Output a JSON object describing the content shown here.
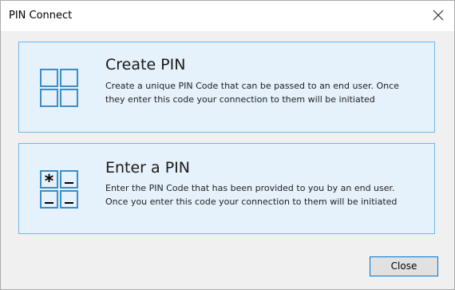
{
  "window": {
    "title": "PIN Connect",
    "close_icon": "close-icon"
  },
  "options": [
    {
      "title": "Create PIN",
      "description_line1": "Create a unique PIN Code that can be passed to an end user. Once",
      "description_line2": "they enter this code your connection to them will be initiated",
      "icon": "grid-icon"
    },
    {
      "title": "Enter a PIN",
      "description_line1": "Enter the PIN Code that has been provided to you by an end user.",
      "description_line2": "Once you enter this code your connection to them will be initiated",
      "icon": "pin-entry-icon",
      "icon_symbol": "*"
    }
  ],
  "footer": {
    "close_label": "Close"
  },
  "colors": {
    "option_background": "#e5f1fb",
    "option_border": "#70b8e6",
    "icon_stroke": "#3c8dc8",
    "button_border": "#0078d7"
  }
}
